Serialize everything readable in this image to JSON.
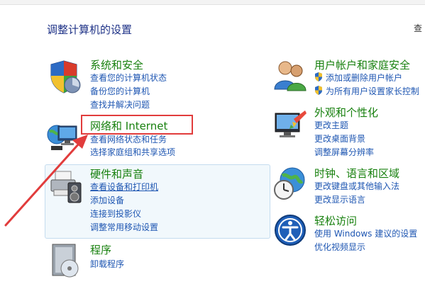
{
  "header": {
    "title": "调整计算机的设置",
    "view_by": "查"
  },
  "system": {
    "title": "系统和安全",
    "links": [
      "查看您的计算机状态",
      "备份您的计算机",
      "查找并解决问题"
    ]
  },
  "network": {
    "title": "网络和 Internet",
    "links": [
      "查看网络状态和任务",
      "选择家庭组和共享选项"
    ]
  },
  "hardware": {
    "title": "硬件和声音",
    "links": [
      "查看设备和打印机",
      "添加设备",
      "连接到投影仪",
      "调整常用移动设置"
    ]
  },
  "programs": {
    "title": "程序",
    "links": [
      "卸载程序"
    ]
  },
  "users": {
    "title": "用户帐户和家庭安全",
    "links": [
      "添加或删除用户帐户",
      "为所有用户设置家长控制"
    ]
  },
  "appearance": {
    "title": "外观和个性化",
    "links": [
      "更改主题",
      "更改桌面背景",
      "调整屏幕分辨率"
    ]
  },
  "clock": {
    "title": "时钟、语言和区域",
    "links": [
      "更改键盘或其他输入法",
      "更改显示语言"
    ]
  },
  "ease": {
    "title": "轻松访问",
    "links": [
      "使用 Windows 建议的设置",
      "优化视频显示"
    ]
  },
  "colors": {
    "title": "#1e3287",
    "category": "#17800e",
    "link": "#1e56b2",
    "highlight": "#e13c3c"
  }
}
